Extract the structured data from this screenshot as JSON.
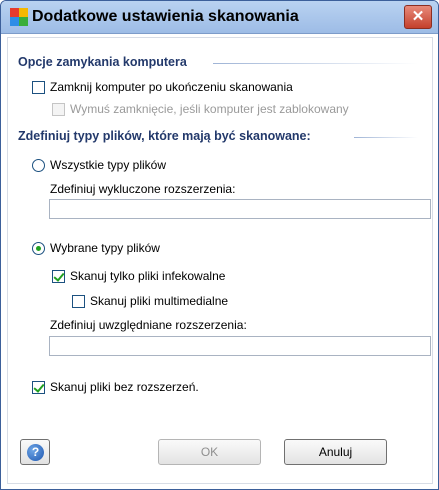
{
  "window": {
    "title": "Dodatkowe ustawienia skanowania",
    "close_glyph": "✕"
  },
  "shutdown_section": {
    "title": "Opcje zamykania komputera",
    "shutdown_after_scan": {
      "label": "Zamknij komputer po ukończeniu skanowania",
      "checked": false,
      "enabled": true
    },
    "force_shutdown": {
      "label": "Wymuś zamknięcie, jeśli komputer jest zablokowany",
      "checked": false,
      "enabled": false
    }
  },
  "file_types_section": {
    "title": "Zdefiniuj typy plików, które mają być skanowane:",
    "all_types": {
      "label": "Wszystkie typy plików",
      "selected": false
    },
    "excluded_extensions": {
      "label": "Zdefiniuj wykluczone rozszerzenia:",
      "value": ""
    },
    "selected_types": {
      "label": "Wybrane typy plików",
      "selected": true
    },
    "infectable_only": {
      "label": "Skanuj tylko pliki infekowalne",
      "checked": true
    },
    "multimedia": {
      "label": "Skanuj pliki multimedialne",
      "checked": false
    },
    "included_extensions": {
      "label": "Zdefiniuj uwzględniane rozszerzenia:",
      "value": ""
    },
    "no_extension": {
      "label": "Skanuj pliki bez rozszerzeń.",
      "checked": true
    }
  },
  "buttons": {
    "help_glyph": "?",
    "ok": "OK",
    "cancel": "Anuluj"
  },
  "icons": {
    "app": "avg-app-icon",
    "close": "close-icon",
    "help": "help-icon"
  }
}
